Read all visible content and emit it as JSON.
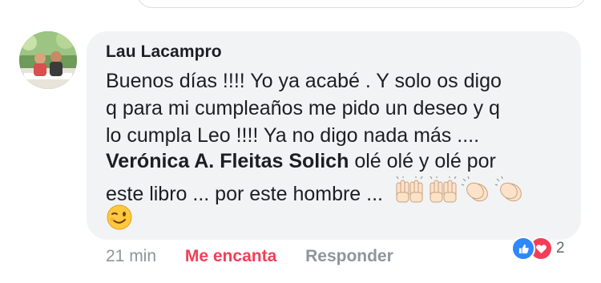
{
  "comment": {
    "author": "Lau Lacampro",
    "lines": [
      "Buenos días !!!! Yo ya acabé . Y solo os digo",
      "q para mi cumpleaños me pido un deseo y q",
      "lo cumpla Leo !!!! Ya no digo nada más ....",
      "olé olé y olé por",
      "este libro ... por este hombre ..."
    ],
    "mention": "Verónica A. Fleitas Solich",
    "emojis": [
      "raising-hands",
      "raising-hands",
      "clapping-hands",
      "clapping-hands",
      "winking-face"
    ]
  },
  "actions": {
    "time": "21 min",
    "love": "Me encanta",
    "reply": "Responder"
  },
  "reactions": {
    "icons": [
      "like-icon",
      "love-icon"
    ],
    "count": "2"
  },
  "colors": {
    "bubble": "#f2f3f5",
    "love_accent": "#f33e58",
    "like_blue": "#2d88ff",
    "meta_gray": "#90949c"
  }
}
